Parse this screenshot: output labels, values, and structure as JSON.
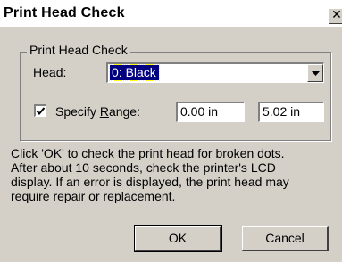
{
  "window": {
    "title": "Print Head Check",
    "close_glyph": "✕"
  },
  "group": {
    "title": "Print Head Check",
    "head_label_prefix": "",
    "head_label_mnemonic": "H",
    "head_label_rest": "ead:",
    "head_selected": "0: Black",
    "specify_range_checked": true,
    "specify_label_prefix": "Specify ",
    "specify_label_mnemonic": "R",
    "specify_label_rest": "ange:",
    "range_start": "0.00 in",
    "range_end": "5.02 in"
  },
  "info": {
    "line1": "Click 'OK' to check the print head for broken dots.",
    "line2": "After about 10 seconds, check the printer's LCD",
    "line3": "display.  If an error is displayed, the print head may",
    "line4": "require repair or replacement."
  },
  "buttons": {
    "ok": "OK",
    "cancel": "Cancel"
  },
  "icons": {
    "close": "close-icon",
    "dropdown": "chevron-down-icon",
    "checkmark": "checkmark-icon"
  }
}
